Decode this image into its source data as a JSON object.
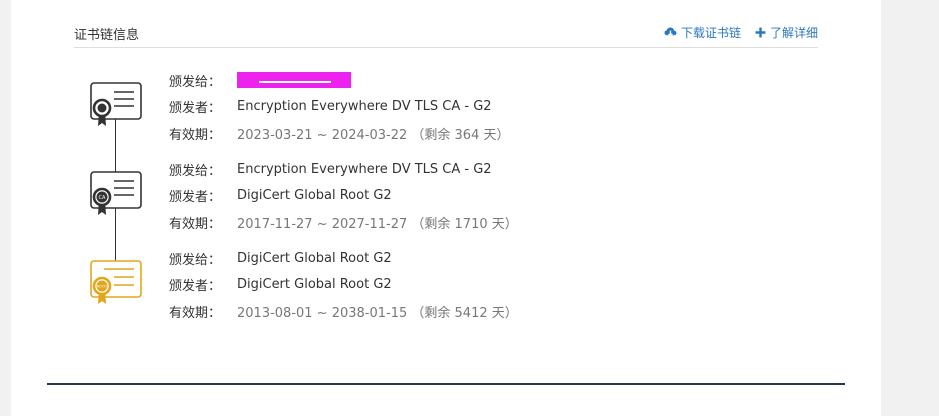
{
  "section": {
    "title": "证书链信息",
    "actions": {
      "download": "下载证书链",
      "learn_more": "了解详细"
    }
  },
  "labels": {
    "issued_to": "颁发给：",
    "issued_by": "颁发者：",
    "validity": "有效期："
  },
  "certs": [
    {
      "badge": "",
      "issued_to": "",
      "issued_by": "Encryption Everywhere DV TLS CA - G2",
      "validity": "2023-03-21 ~ 2024-03-22 （剩余 364 天）"
    },
    {
      "badge": "CA",
      "issued_to": "Encryption Everywhere DV TLS CA - G2",
      "issued_by": "DigiCert Global Root G2",
      "validity": "2017-11-27 ~ 2027-11-27 （剩余 1710 天）"
    },
    {
      "badge": "ROOT",
      "issued_to": "DigiCert Global Root G2",
      "issued_by": "DigiCert Global Root G2",
      "validity": "2013-08-01 ~ 2038-01-15 （剩余 5412 天）"
    }
  ],
  "colors": {
    "link": "#2a78c2",
    "root_cert": "#e3a71b",
    "cert": "#333333",
    "redaction": "#ee22ee",
    "footer_rule": "#2a3550"
  },
  "icons": {
    "download": "cloud-download-icon",
    "learn_more": "plus-icon",
    "leaf_cert": "certificate-icon",
    "ca_cert": "ca-certificate-icon",
    "root_cert": "root-certificate-icon"
  }
}
